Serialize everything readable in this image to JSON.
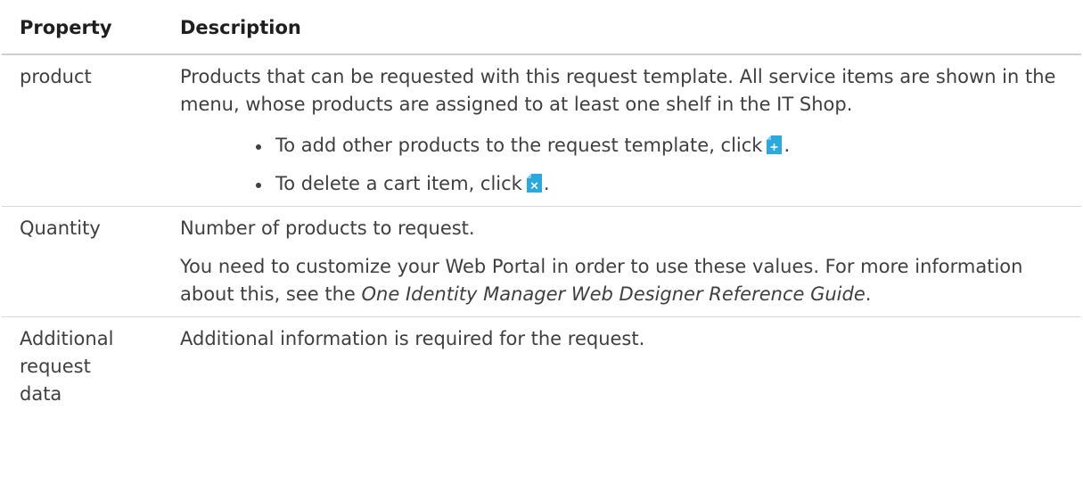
{
  "table": {
    "headers": [
      "Property",
      "Description"
    ],
    "rows": [
      {
        "property": "product",
        "description": "Products that can be requested with this request template. All service items are shown in the menu, whose products are assigned to at least one shelf in the IT Shop.",
        "bullets": [
          {
            "text": "To add other products to the request template, click",
            "icon": "add-file-icon",
            "suffix": "."
          },
          {
            "text": "To delete a cart item, click",
            "icon": "delete-file-icon",
            "suffix": "."
          }
        ]
      },
      {
        "property": "Quantity",
        "description": "Number of products to request.",
        "note_prefix": "You need to customize your Web Portal in order to use these values. For more information about this, see the ",
        "note_ref": "One Identity Manager Web Designer Reference Guide",
        "note_suffix": "."
      },
      {
        "property_lines": [
          "Additional",
          "request",
          "data"
        ],
        "description": "Additional information is required for the request."
      }
    ]
  },
  "colors": {
    "icon_fill": "#29a9df",
    "icon_corner": "#7fd0f0",
    "text": "#3f3f3f",
    "rule": "#cfcfcf"
  }
}
